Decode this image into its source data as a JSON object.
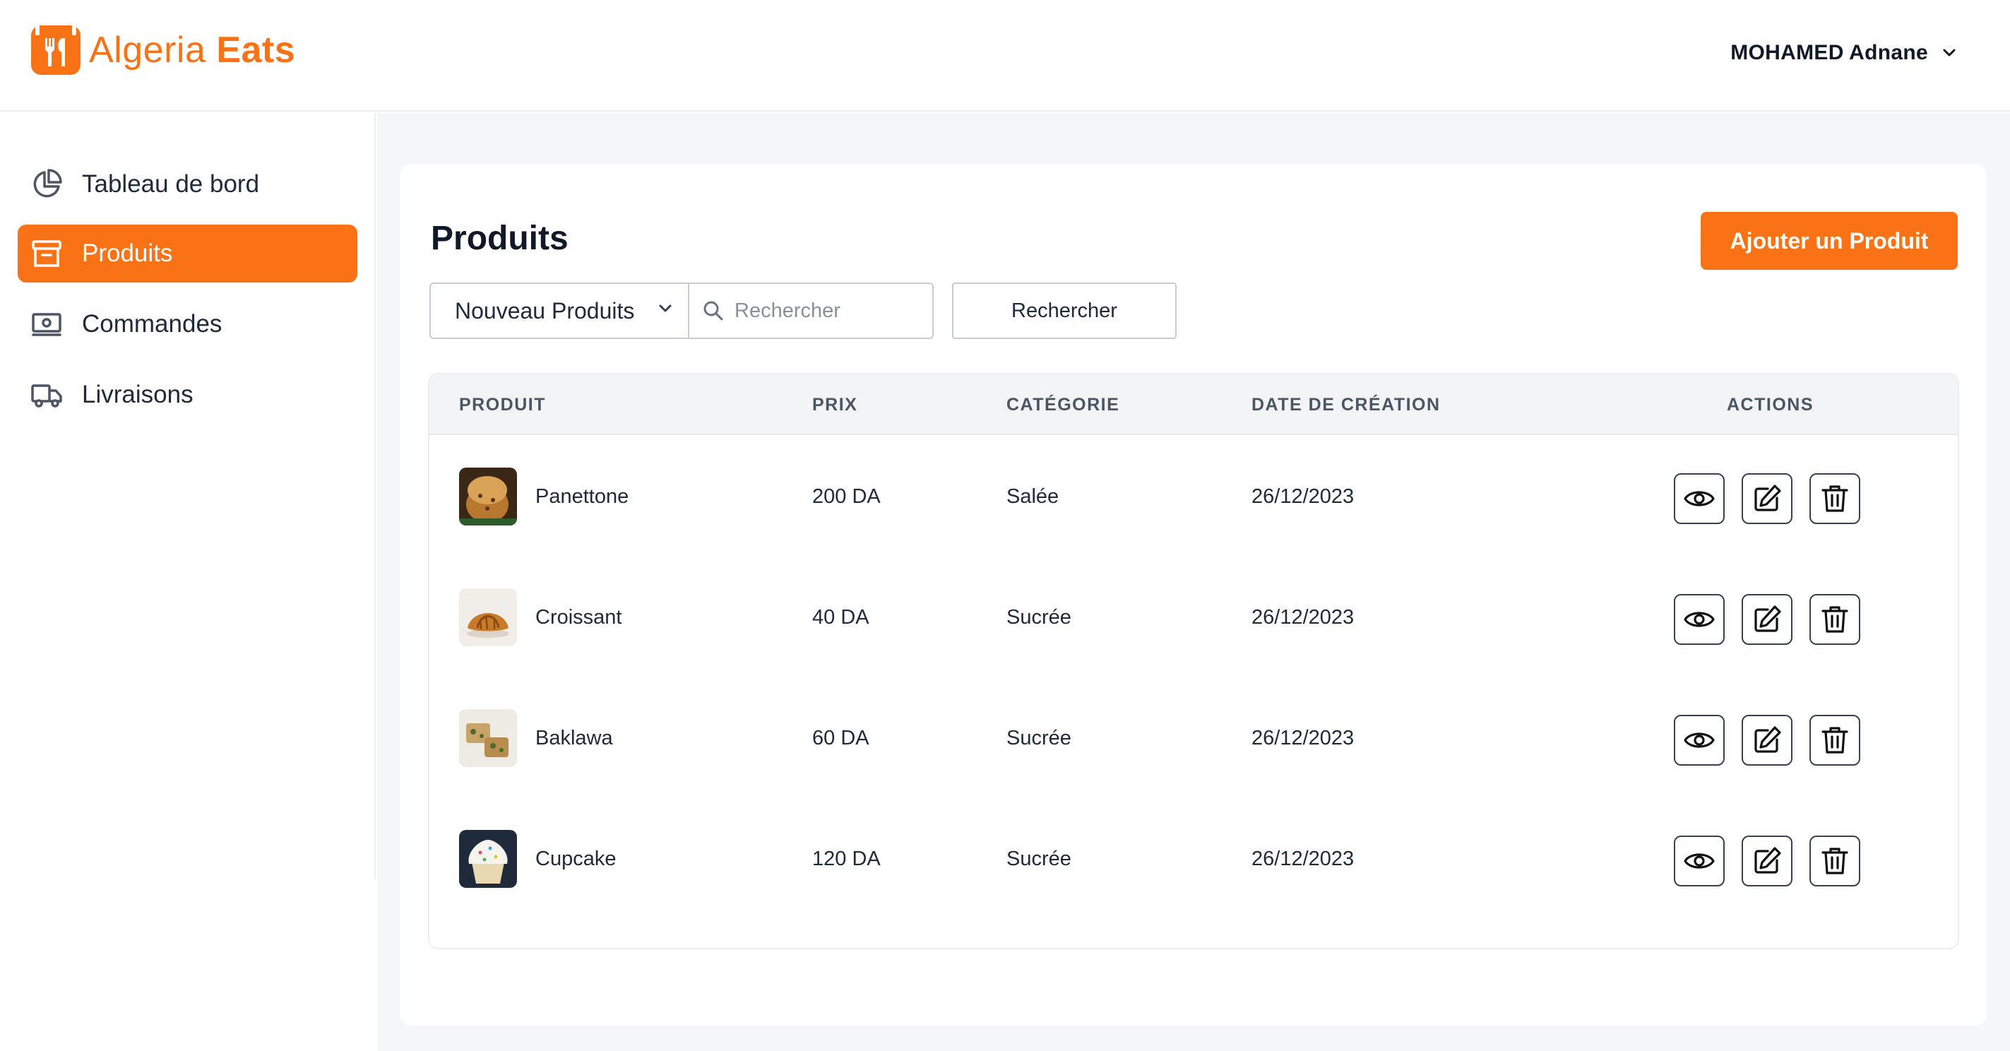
{
  "app": {
    "logo_text_1": "Algeria",
    "logo_text_2": "Eats",
    "brand_color": "#f97316"
  },
  "header": {
    "user_name": "MOHAMED Adnane",
    "user_menu_icon": "chevron-down-icon"
  },
  "sidebar": {
    "items": [
      {
        "label": "Tableau de bord",
        "icon": "pie-chart-icon",
        "active": false
      },
      {
        "label": "Produits",
        "icon": "archive-box-icon",
        "active": true
      },
      {
        "label": "Commandes",
        "icon": "banknote-icon",
        "active": false
      },
      {
        "label": "Livraisons",
        "icon": "truck-icon",
        "active": false
      }
    ]
  },
  "page": {
    "title": "Produits",
    "add_button": "Ajouter un Produit"
  },
  "filters": {
    "select_value": "Nouveau Produits",
    "search_placeholder": "Rechercher",
    "search_button": "Rechercher"
  },
  "table": {
    "headers": [
      "PRODUIT",
      "PRIX",
      "CATÉGORIE",
      "DATE DE CRÉATION",
      "ACTIONS"
    ],
    "rows": [
      {
        "name": "Panettone",
        "price": "200 DA",
        "category": "Salée",
        "date": "26/12/2023"
      },
      {
        "name": "Croissant",
        "price": "40 DA",
        "category": "Sucrée",
        "date": "26/12/2023"
      },
      {
        "name": "Baklawa",
        "price": "60 DA",
        "category": "Sucrée",
        "date": "26/12/2023"
      },
      {
        "name": "Cupcake",
        "price": "120 DA",
        "category": "Sucrée",
        "date": "26/12/2023"
      }
    ],
    "row_actions": [
      "eye-icon",
      "edit-icon",
      "trash-icon"
    ]
  }
}
